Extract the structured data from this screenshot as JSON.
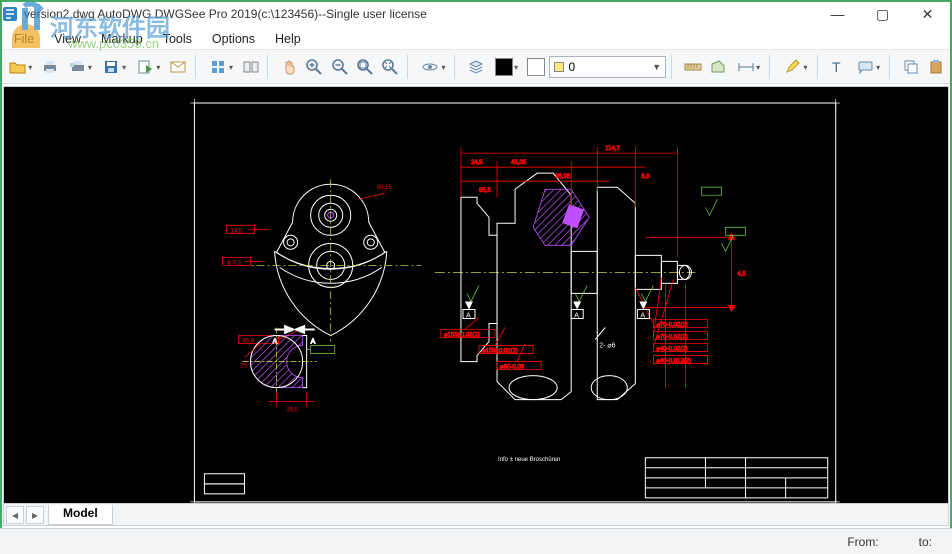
{
  "window": {
    "title": "version2.dwg AutoDWG DWGSee Pro 2019(c:\\123456)--Single user license"
  },
  "menu": {
    "file": "File",
    "view": "View",
    "markup": "Markup",
    "tools": "Tools",
    "options": "Options",
    "help": "Help"
  },
  "toolbar": {
    "layer_value": "0"
  },
  "tabs": {
    "model": "Model"
  },
  "statusbar": {
    "from": "From:",
    "to": "to:"
  },
  "drawing": {
    "section_label_A1": "A",
    "section_label_A2": "A",
    "detail_label": "2- ⌀6",
    "note1": "⌀155±0,02(2)",
    "note2": "⌀155±0,02(2)",
    "note3": "⌀70-0,02(2)",
    "note4": "⌀70-0,02(2)",
    "note5": "⌀40-0,02(2)",
    "note6": "⌀40-0,012(2)",
    "dim_1147": "114,7",
    "dim_3505": "35,05",
    "dim_60": "6,0",
    "dim_25": "25",
    "dim_355": "35,5",
    "dim_955": "95,5",
    "dim_4505": "45,05",
    "dim_245": "24,5",
    "dim_8015": "80,15",
    "dim_858": "85,8",
    "dim_145": "14,5",
    "dim_45": "4,5",
    "bottom_note": "Info  ±  neue  Broschüren"
  },
  "watermark": {
    "primary": "河东软件园",
    "url": "www.pc0359.cn"
  }
}
